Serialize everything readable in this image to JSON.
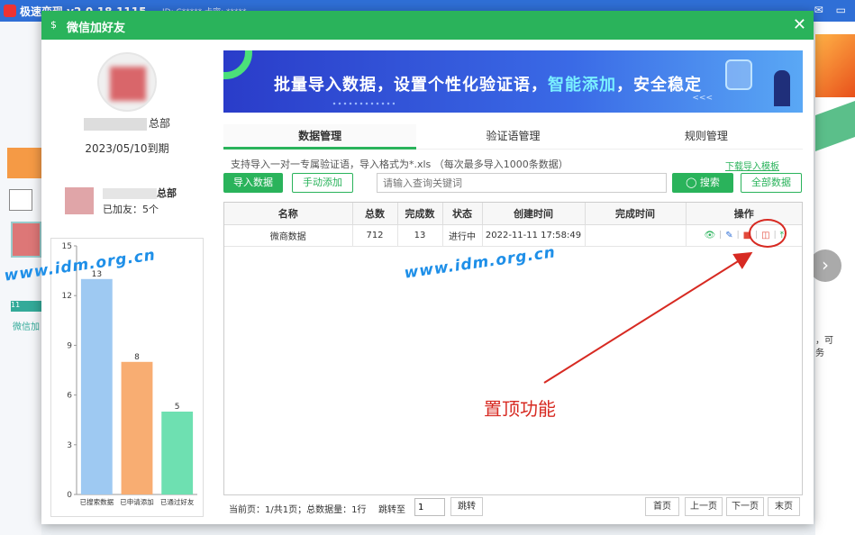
{
  "bg_app": {
    "title": "极速变现 v2.0.18.1115",
    "meta": "ID: C*****  卡密: *****",
    "right_text_1": "，可",
    "right_text_2": "务",
    "left_tag": "11",
    "left_text": "微信加"
  },
  "dialog": {
    "title": "微信加好友",
    "close_icon": "close-icon"
  },
  "profile": {
    "org_suffix": "总部",
    "expire": "2023/05/10到期",
    "account_suffix": "总部",
    "added_friends": "已加友：5个"
  },
  "chart_data": {
    "type": "bar",
    "categories": [
      "已搜索数据",
      "已申请添加",
      "已通过好友"
    ],
    "values": [
      13,
      8,
      5
    ],
    "colors": [
      "#9ec9f2",
      "#f8ad72",
      "#6ee0b1"
    ],
    "ylim": [
      0,
      15
    ],
    "yticks": [
      0,
      3,
      6,
      9,
      12,
      15
    ]
  },
  "banner": {
    "text_main": "批量导入数据，设置个性化验证语，",
    "text_highlight": "智能添加",
    "text_tail": "，安全稳定",
    "chevrons": "<<<"
  },
  "tabs": [
    {
      "label": "数据管理",
      "active": true
    },
    {
      "label": "验证语管理",
      "active": false
    },
    {
      "label": "规则管理",
      "active": false
    }
  ],
  "hint": "支持导入一对一专属验证语，导入格式为*.xls （每次最多导入1000条数据）",
  "download_link": "下载导入模板",
  "toolbar": {
    "import_label": "导入数据",
    "manual_label": "手动添加",
    "search_placeholder": "请输入查询关键词",
    "search_label": "搜索",
    "all_label": "全部数据"
  },
  "table": {
    "headers": [
      "名称",
      "总数",
      "完成数",
      "状态",
      "创建时间",
      "完成时间",
      "操作"
    ],
    "rows": [
      {
        "name": "微商数据",
        "total": "712",
        "done": "13",
        "status": "进行中",
        "created": "2022-11-11 17:58:49",
        "finished": ""
      }
    ]
  },
  "pager": {
    "info": "当前页：1/共1页；总数据量：1行",
    "jump_label": "跳转至",
    "jump_value": "1",
    "jump_btn": "跳转",
    "first": "首页",
    "prev": "上一页",
    "next": "下一页",
    "last": "末页"
  },
  "annotation": {
    "label": "置顶功能",
    "color": "#d72a22"
  },
  "watermark": "www.idm.org.cn",
  "colors": {
    "accent": "#2ab35b",
    "bg_titlebar": "#2f6fd6"
  }
}
